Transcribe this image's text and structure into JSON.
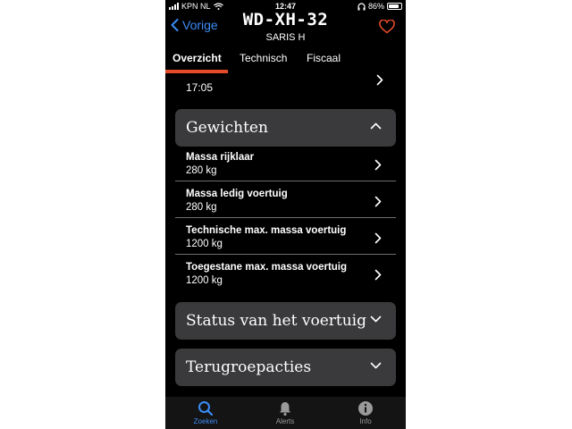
{
  "status_bar": {
    "carrier": "KPN NL",
    "time": "12:47",
    "battery": "86%",
    "battery_level": 0.86,
    "icons": [
      "signal-icon",
      "wifi-icon",
      "headphones-icon",
      "battery-icon"
    ]
  },
  "header": {
    "back_label": "Vorige",
    "plate": "WD-XH-32",
    "subtitle": "SARIS H",
    "favorite_icon": "heart-outline-icon"
  },
  "tabs": [
    {
      "label": "Overzicht",
      "active": true
    },
    {
      "label": "Technisch",
      "active": false
    },
    {
      "label": "Fiscaal",
      "active": false
    }
  ],
  "partial_row": {
    "value": "17:05"
  },
  "sections": {
    "gewichten": {
      "title": "Gewichten",
      "expanded": true,
      "items": [
        {
          "title": "Massa rijklaar",
          "value": "280 kg"
        },
        {
          "title": "Massa ledig voertuig",
          "value": "280 kg"
        },
        {
          "title": "Technische max. massa voertuig",
          "value": "1200 kg"
        },
        {
          "title": "Toegestane max. massa voertuig",
          "value": "1200 kg"
        }
      ]
    },
    "status": {
      "title": "Status van het voertuig",
      "expanded": false
    },
    "terugroep": {
      "title": "Terugroepacties",
      "expanded": false
    }
  },
  "tabbar": [
    {
      "label": "Zoeken",
      "icon": "search-icon",
      "active": true
    },
    {
      "label": "Alerts",
      "icon": "bell-icon",
      "active": false
    },
    {
      "label": "Info",
      "icon": "info-icon",
      "active": false
    }
  ],
  "colors": {
    "accent": "#3b8cf5",
    "tab_underline": "#e34b2b",
    "heart": "#e34b2b",
    "section_bg": "#3a3a3c",
    "background": "#000000"
  }
}
